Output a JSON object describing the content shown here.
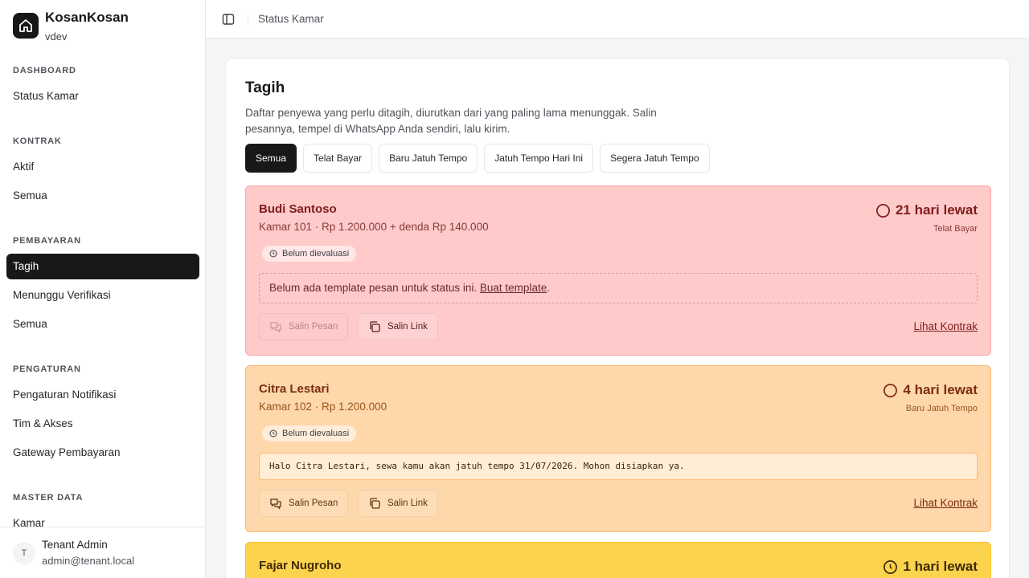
{
  "sidebar": {
    "brand_name": "KosanKosan",
    "brand_sub": "vdev",
    "sections": [
      {
        "heading": "DASHBOARD",
        "items": [
          "Status Kamar"
        ]
      },
      {
        "heading": "KONTRAK",
        "items": [
          "Aktif",
          "Semua"
        ]
      },
      {
        "heading": "PEMBAYARAN",
        "items": [
          "Tagih",
          "Menunggu Verifikasi",
          "Semua"
        ]
      },
      {
        "heading": "PENGATURAN",
        "items": [
          "Pengaturan Notifikasi",
          "Tim & Akses",
          "Gateway Pembayaran"
        ]
      },
      {
        "heading": "MASTER DATA",
        "items": [
          "Kamar"
        ]
      }
    ],
    "active_item": "Tagih",
    "user": {
      "initial": "T",
      "name": "Tenant Admin",
      "email": "admin@tenant.local"
    }
  },
  "topbar": {
    "breadcrumb": "Status Kamar"
  },
  "main": {
    "title": "Tagih",
    "description": "Daftar penyewa yang perlu ditagih, diurutkan dari yang paling lama menunggak. Salin pesannya, tempel di WhatsApp Anda sendiri, lalu kirim.",
    "filters": [
      "Semua",
      "Telat Bayar",
      "Baru Jatuh Tempo",
      "Jatuh Tempo Hari Ini",
      "Segera Jatuh Tempo"
    ],
    "active_filter": "Semua",
    "cards": [
      {
        "name": "Budi Santoso",
        "subtitle": "Kamar 101 · Rp 1.200.000 + denda Rp 140.000",
        "overdue": "21 hari lewat",
        "status": "Telat Bayar",
        "badge": "Belum dievaluasi",
        "empty_prefix": "Belum ada template pesan untuk status ini. ",
        "empty_link": "Buat template",
        "empty_suffix": ".",
        "copy_message": "Salin Pesan",
        "copy_link": "Salin Link",
        "view_contract": "Lihat Kontrak",
        "color": "#fecaca"
      },
      {
        "name": "Citra Lestari",
        "subtitle": "Kamar 102 · Rp 1.200.000",
        "overdue": "4 hari lewat",
        "status": "Baru Jatuh Tempo",
        "badge": "Belum dievaluasi",
        "message": "Halo Citra Lestari, sewa kamu akan jatuh tempo 31/07/2026. Mohon disiapkan ya.",
        "copy_message": "Salin Pesan",
        "copy_link": "Salin Link",
        "view_contract": "Lihat Kontrak",
        "color": "#fed7aa"
      },
      {
        "name": "Fajar Nugroho",
        "overdue": "1 hari lewat",
        "color": "#fcd34d"
      }
    ]
  }
}
